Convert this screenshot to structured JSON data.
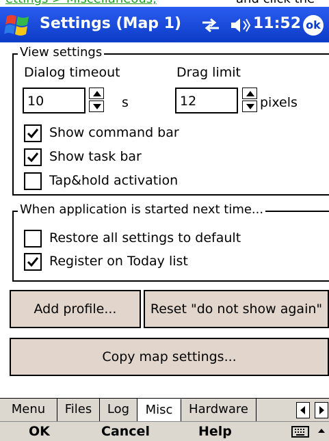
{
  "crop": {
    "link_text": "ettings > Miscellaneous,",
    "tail_text": "and click the"
  },
  "titlebar": {
    "title": "Settings (Map 1)",
    "clock": "11:52",
    "ok": "ok"
  },
  "view_settings": {
    "legend": "View settings",
    "dialog_timeout_label": "Dialog timeout",
    "dialog_timeout_value": "10",
    "seconds_unit": "s",
    "drag_limit_label": "Drag limit",
    "drag_limit_value": "12",
    "pixels_unit": "pixels",
    "checkboxes": [
      {
        "label": "Show command bar",
        "checked": true
      },
      {
        "label": "Show task bar",
        "checked": true
      },
      {
        "label": "Tap&hold activation",
        "checked": false
      }
    ]
  },
  "next_time": {
    "legend": "When application is started next time...",
    "checkboxes": [
      {
        "label": "Restore all settings to default",
        "checked": false
      },
      {
        "label": "Register on Today list",
        "checked": true
      }
    ]
  },
  "buttons": {
    "add_profile": "Add profile...",
    "reset_dont_show": "Reset \"do not show again\"",
    "copy_map": "Copy map settings..."
  },
  "tabs": [
    {
      "label": "Menu",
      "active": false
    },
    {
      "label": "Files",
      "active": false
    },
    {
      "label": "Log",
      "active": false
    },
    {
      "label": "Misc",
      "active": true
    },
    {
      "label": "Hardware",
      "active": false
    }
  ],
  "commands": {
    "ok": "OK",
    "cancel": "Cancel",
    "help": "Help"
  }
}
